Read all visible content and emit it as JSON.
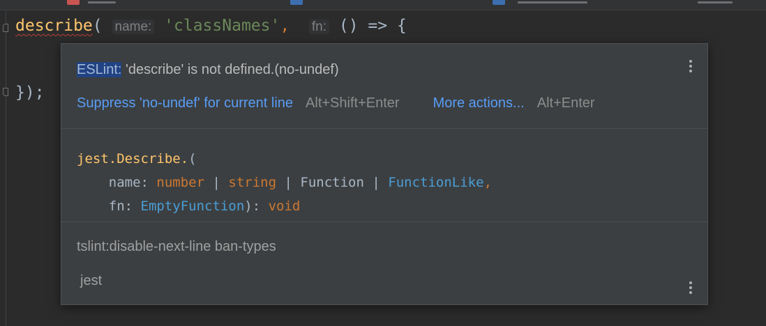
{
  "editor": {
    "line1": {
      "fn": "describe",
      "paren_open": "(",
      "hint_name": "name:",
      "arg_string": "'classNames'",
      "comma": ",",
      "hint_fn": "fn:",
      "arrow": "() => {"
    },
    "line2": {
      "close": "});",
      "semicolon": ""
    }
  },
  "popup": {
    "problem": {
      "tag": "ESLint:",
      "message": "'describe' is not defined.(no-undef)"
    },
    "actions": {
      "suppress_label": "Suppress 'no-undef' for current line",
      "suppress_shortcut": "Alt+Shift+Enter",
      "more_label": "More actions...",
      "more_shortcut": "Alt+Enter"
    },
    "signature": {
      "fn": "jest.Describe.",
      "open": "(",
      "param_name": "name:",
      "type_number": "number",
      "sep1": "|",
      "type_string": "string",
      "sep2": "|",
      "type_function": "Function",
      "sep3": "|",
      "type_function_like": "FunctionLike",
      "comma": ",",
      "param_fn": "fn:",
      "type_empty_function": "EmptyFunction",
      "close": "):",
      "return_type": "void"
    },
    "tags": {
      "tslint": "tslint:disable-next-line ban-types",
      "module": "jest"
    }
  },
  "colors": {
    "editor_bg": "#2b2b2b",
    "popup_bg": "#3c3f41",
    "link": "#589df6",
    "function": "#ffc66d",
    "keyword": "#cc7832",
    "string": "#6a8759",
    "type_ref": "#4a9ed6",
    "error_underline": "#bc3f3c"
  },
  "icons": {
    "popup_menu": "kebab-vertical-icon",
    "fold_open": "fold-open-icon",
    "fold_close": "fold-close-icon"
  }
}
